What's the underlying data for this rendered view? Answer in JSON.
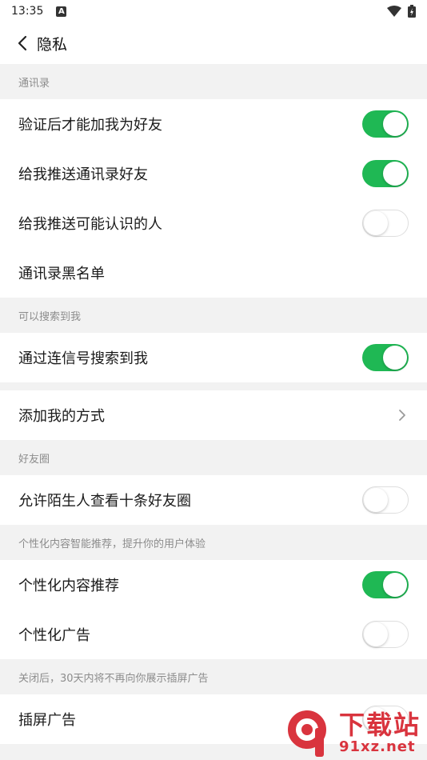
{
  "status_bar": {
    "time": "13:35",
    "notification_icon": "a-icon"
  },
  "header": {
    "back_icon": "chevron-left-icon",
    "title": "隐私"
  },
  "sections": {
    "contacts": {
      "label": "通讯录",
      "items": [
        {
          "label": "验证后才能加我为好友",
          "toggle": true
        },
        {
          "label": "给我推送通讯录好友",
          "toggle": true
        },
        {
          "label": "给我推送可能认识的人",
          "toggle": false
        },
        {
          "label": "通讯录黑名单"
        }
      ]
    },
    "searchable": {
      "label": "可以搜索到我",
      "items": [
        {
          "label": "通过连信号搜索到我",
          "toggle": true
        }
      ]
    },
    "add_method": {
      "label": "添加我的方式",
      "icon": "chevron-right-icon"
    },
    "moments": {
      "label": "好友圈",
      "items": [
        {
          "label": "允许陌生人查看十条好友圈",
          "toggle": false
        }
      ]
    },
    "personalization": {
      "label": "个性化内容智能推荐，提升你的用户体验",
      "items": [
        {
          "label": "个性化内容推荐",
          "toggle": true
        },
        {
          "label": "个性化广告",
          "toggle": false
        }
      ]
    },
    "interstitial": {
      "label": "关闭后，30天内将不再向你展示插屏广告",
      "items": [
        {
          "label": "插屏广告",
          "toggle": false
        }
      ]
    }
  },
  "watermark": {
    "big": "下载站",
    "small": "91xz.net"
  },
  "colors": {
    "toggle_on": "#1fb854",
    "background": "#f2f2f2",
    "watermark": "#d9343e"
  }
}
